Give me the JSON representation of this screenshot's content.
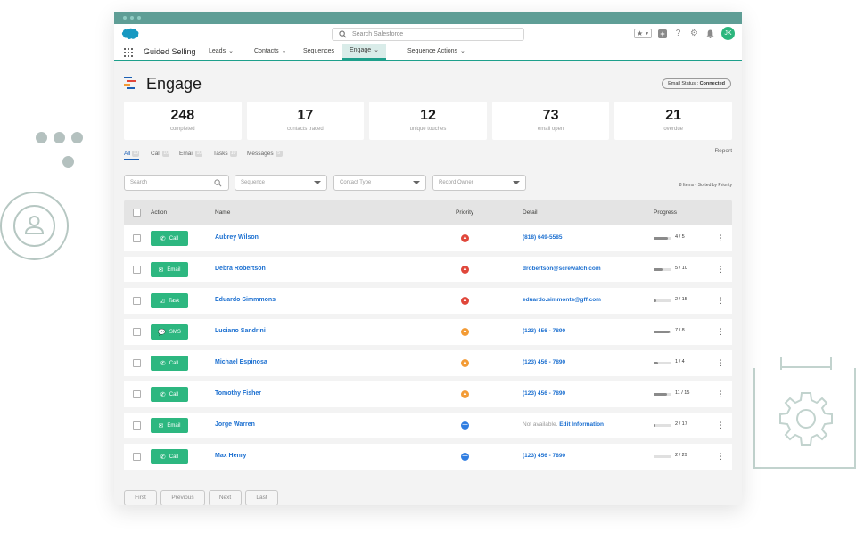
{
  "header": {
    "search_placeholder": "Search Salesforce",
    "user_initials": "JK"
  },
  "nav": {
    "app_name": "Guided Selling",
    "items": [
      {
        "label": "Leads",
        "has_menu": true
      },
      {
        "label": "Contacts",
        "has_menu": true
      },
      {
        "label": "Sequences",
        "has_menu": false
      },
      {
        "label": "Engage",
        "has_menu": true,
        "active": true
      },
      {
        "label": "Sequence Actions",
        "has_menu": true
      }
    ]
  },
  "page": {
    "title": "Engage",
    "email_status_label": "Email Status :",
    "email_status_value": "Connected"
  },
  "stats": [
    {
      "value": "248",
      "label": "completed"
    },
    {
      "value": "17",
      "label": "contacts traced"
    },
    {
      "value": "12",
      "label": "unique touches"
    },
    {
      "value": "73",
      "label": "email open"
    },
    {
      "value": "21",
      "label": "overdue"
    }
  ],
  "tabs": [
    {
      "label": "All",
      "count": "10",
      "active": true
    },
    {
      "label": "Call",
      "count": "10"
    },
    {
      "label": "Email",
      "count": "10"
    },
    {
      "label": "Tasks",
      "count": "10"
    },
    {
      "label": "Messages",
      "count": "5"
    }
  ],
  "report_label": "Report",
  "filters": {
    "search_placeholder": "Search",
    "sequence": "Sequence",
    "contact_type": "Contact Type",
    "record_owner": "Record Owner",
    "summary": "8 Items • Sorted by Priority"
  },
  "table": {
    "columns": {
      "action": "Action",
      "name": "Name",
      "priority": "Priority",
      "detail": "Detail",
      "progress": "Progress"
    },
    "rows": [
      {
        "action": "Call",
        "action_icon": "phone-icon",
        "name": "Aubrey Wilson",
        "priority": "high",
        "detail": "(818) 649-5585",
        "progress_text": "4 / 5",
        "progress_fraction": 0.8
      },
      {
        "action": "Email",
        "action_icon": "envelope-icon",
        "name": "Debra Robertson",
        "priority": "high",
        "detail": "drobertson@screwatch.com",
        "progress_text": "5 / 10",
        "progress_fraction": 0.5
      },
      {
        "action": "Task",
        "action_icon": "task-icon",
        "name": "Eduardo Simmmons",
        "priority": "high",
        "detail": "eduardo.simmonts@gff.com",
        "progress_text": "2 / 15",
        "progress_fraction": 0.13
      },
      {
        "action": "SMS",
        "action_icon": "chat-icon",
        "name": "Luciano Sandrini",
        "priority": "medium",
        "detail": "(123) 456 - 7890",
        "progress_text": "7 / 8",
        "progress_fraction": 0.88
      },
      {
        "action": "Call",
        "action_icon": "phone-icon",
        "name": "Michael Espinosa",
        "priority": "medium",
        "detail": "(123) 456 - 7890",
        "progress_text": "1 / 4",
        "progress_fraction": 0.25
      },
      {
        "action": "Call",
        "action_icon": "phone-icon",
        "name": "Tomothy Fisher",
        "priority": "medium",
        "detail": "(123) 456 - 7890",
        "progress_text": "11 / 15",
        "progress_fraction": 0.73
      },
      {
        "action": "Email",
        "action_icon": "envelope-icon",
        "name": "Jorge Warren",
        "priority": "low",
        "detail_prefix": "Not available.",
        "detail": "Edit Information",
        "progress_text": "2 / 17",
        "progress_fraction": 0.12
      },
      {
        "action": "Call",
        "action_icon": "phone-icon",
        "name": "Max Henry",
        "priority": "low",
        "detail": "(123) 456 - 7890",
        "progress_text": "2 / 29",
        "progress_fraction": 0.07
      }
    ]
  },
  "pager": {
    "first": "First",
    "previous": "Previous",
    "next": "Next",
    "last": "Last"
  },
  "colors": {
    "brand_teal": "#1d9f8b",
    "action_green": "#2db780",
    "link_blue": "#1b6fd0",
    "priority_high": "#e0473b",
    "priority_medium": "#f39b35",
    "priority_low": "#2f7de1"
  }
}
